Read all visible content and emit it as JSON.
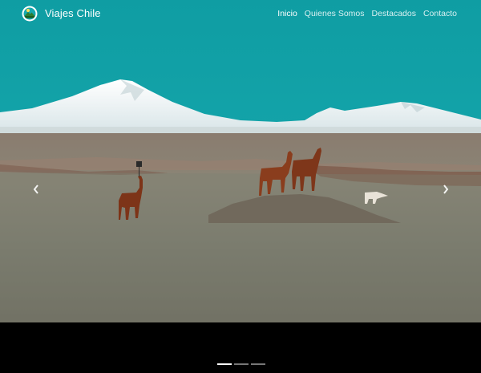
{
  "navbar": {
    "brand": {
      "name": "Viajes Chile",
      "logo_icon": "mountain-sun-logo-icon"
    },
    "links": [
      {
        "label": "Inicio",
        "active": true
      },
      {
        "label": "Quienes Somos",
        "active": false
      },
      {
        "label": "Destacados",
        "active": false
      },
      {
        "label": "Contacto",
        "active": false
      }
    ]
  },
  "carousel": {
    "prev_icon": "chevron-left-icon",
    "next_icon": "chevron-right-icon",
    "slide_count": 3,
    "active_slide": 1
  },
  "colors": {
    "sky": "#13a3a8",
    "snow": "#eef3f4",
    "plain": "#7a7466",
    "llama": "#7d3418",
    "band": "#000000"
  }
}
